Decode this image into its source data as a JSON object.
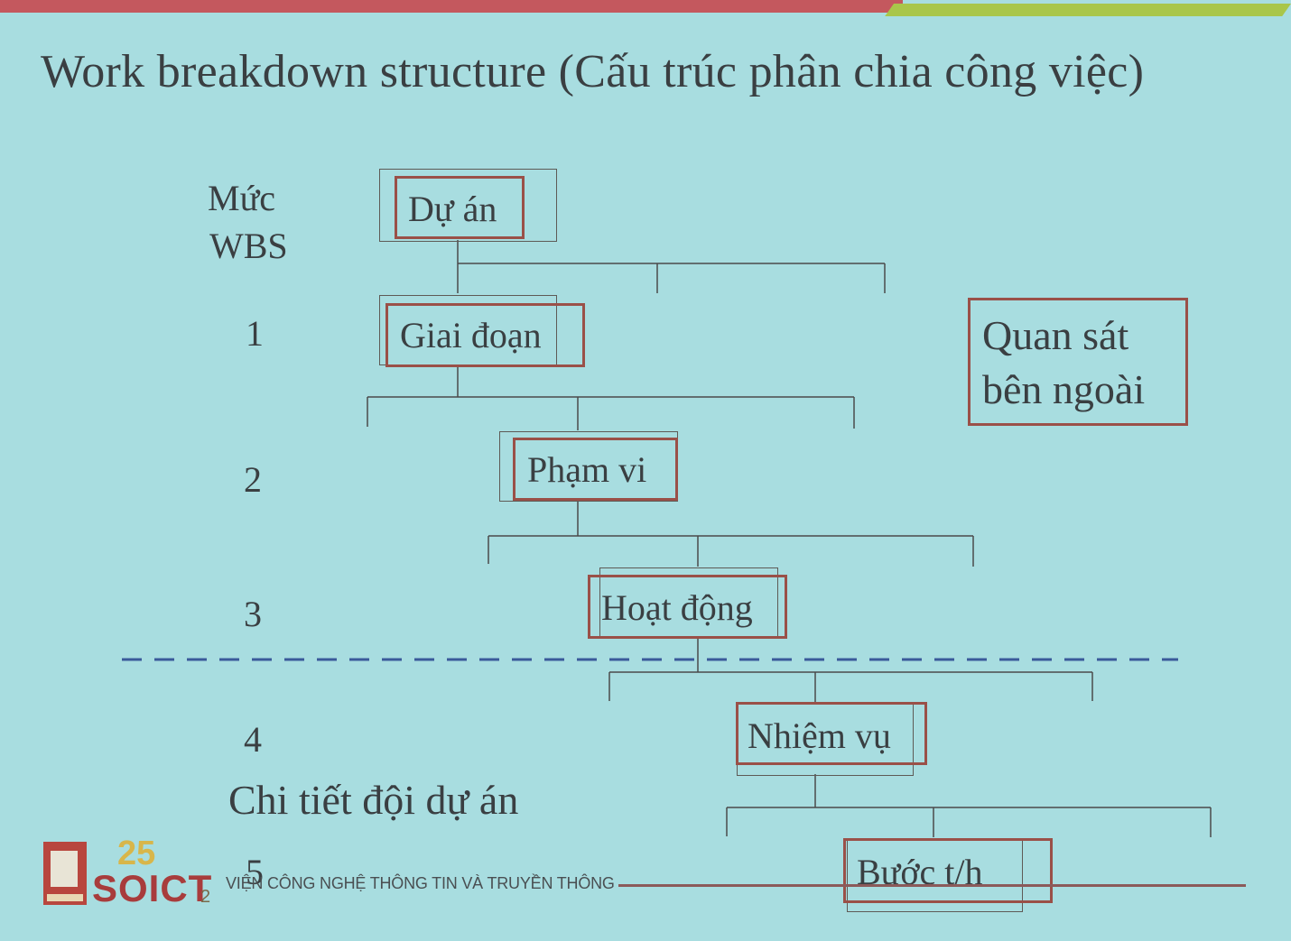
{
  "title": "Work breakdown structure (Cấu trúc phân chia công việc)",
  "levels": {
    "header_line1": "Mức",
    "header_line2": "WBS",
    "l1": "1",
    "l2": "2",
    "l3": "3",
    "l4": "4",
    "l5": "5"
  },
  "nodes": {
    "project": "Dự án",
    "phase": "Giai đoạn",
    "scope": "Phạm vi",
    "activity": "Hoạt động",
    "task": "Nhiệm vụ",
    "step": "Bước t/h"
  },
  "annotations": {
    "external_line1": "Quan sát",
    "external_line2": "bên ngoài",
    "team_detail": "Chi tiết đội dự án"
  },
  "footer": {
    "institute": "VIỆN CÔNG NGHỆ THÔNG TIN VÀ TRUYỀN THÔNG",
    "logo_text": "SOICT",
    "logo_number": "25",
    "date_fragment": "2"
  },
  "colors": {
    "background": "#a8dde0",
    "box_border": "#9a5048",
    "dashed_line": "#3a5a9a",
    "accent_red": "#c4585e",
    "accent_green": "#a9c64a"
  }
}
